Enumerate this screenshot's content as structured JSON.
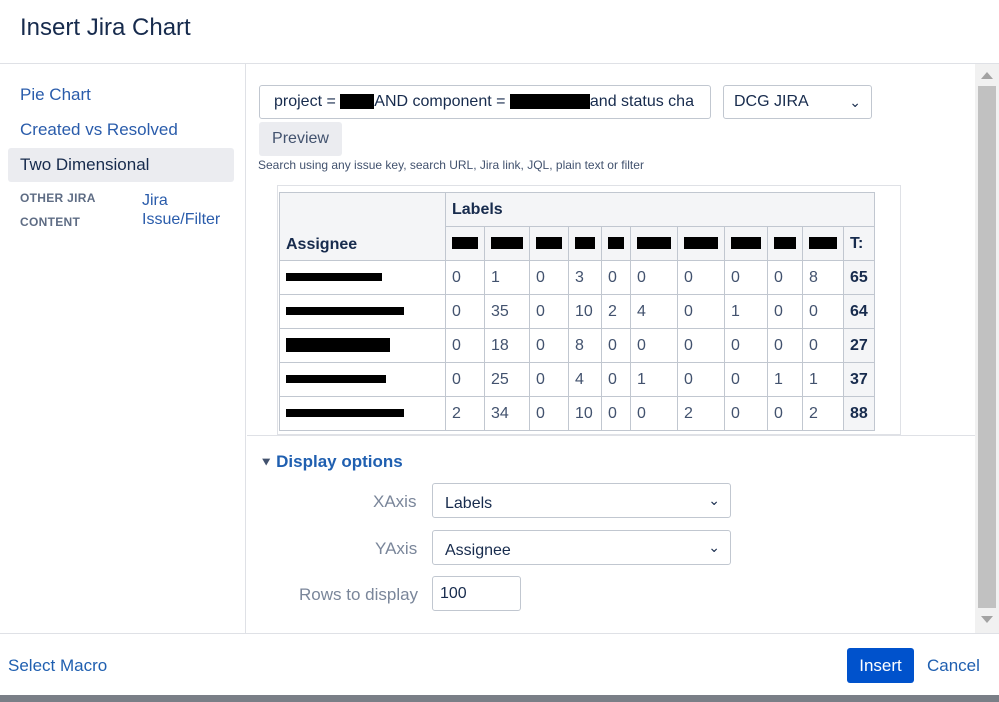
{
  "dialog": {
    "title": "Insert Jira Chart"
  },
  "sidebar": {
    "items": [
      {
        "label": "Pie Chart"
      },
      {
        "label": "Created vs Resolved"
      },
      {
        "label": "Two Dimensional",
        "active": true
      }
    ],
    "other_section": {
      "heading_line1": "OTHER JIRA",
      "heading_line2": "CONTENT",
      "link_line1": "Jira",
      "link_line2": "Issue/Filter"
    }
  },
  "search": {
    "query_part1": "project = ",
    "query_part2": "AND component = ",
    "query_part3": "and status cha",
    "hint": "Search using any issue key, search URL, Jira link, JQL, plain text or filter"
  },
  "server_select": {
    "value": "DCG JIRA"
  },
  "preview_button": {
    "label": "Preview"
  },
  "table": {
    "header_group": "Labels",
    "row_header": "Assignee",
    "total_header": "T:",
    "rows": [
      {
        "values": [
          "0",
          "1",
          "0",
          "3",
          "0",
          "0",
          "0",
          "0",
          "0",
          "8"
        ],
        "total": "65"
      },
      {
        "values": [
          "0",
          "35",
          "0",
          "10",
          "2",
          "4",
          "0",
          "1",
          "0",
          "0"
        ],
        "total": "64"
      },
      {
        "values": [
          "0",
          "18",
          "0",
          "8",
          "0",
          "0",
          "0",
          "0",
          "0",
          "0"
        ],
        "total": "27"
      },
      {
        "values": [
          "0",
          "25",
          "0",
          "4",
          "0",
          "1",
          "0",
          "0",
          "1",
          "1"
        ],
        "total": "37"
      },
      {
        "values": [
          "2",
          "34",
          "0",
          "10",
          "0",
          "0",
          "2",
          "0",
          "0",
          "2"
        ],
        "total": "88"
      }
    ]
  },
  "display_options": {
    "toggle_label": "Display options",
    "xaxis": {
      "label": "XAxis",
      "value": "Labels"
    },
    "yaxis": {
      "label": "YAxis",
      "value": "Assignee"
    },
    "rows": {
      "label": "Rows to display",
      "value": "100"
    }
  },
  "footer": {
    "select_macro": "Select Macro",
    "insert": "Insert",
    "cancel": "Cancel"
  },
  "colors": {
    "primary": "#0052cc",
    "link": "#1f5fb0",
    "active_bg": "#ebecf0"
  }
}
